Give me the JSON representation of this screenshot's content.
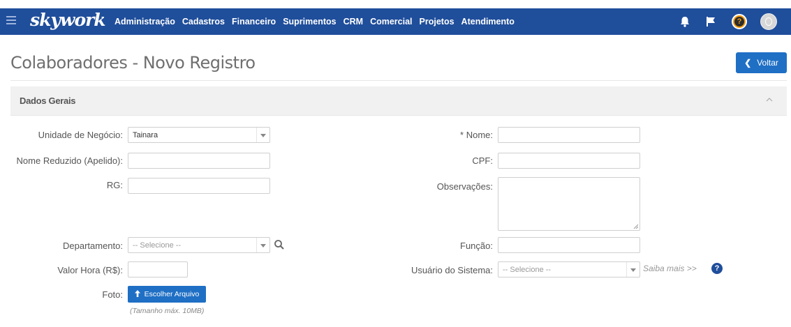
{
  "app": {
    "logo": "skywork",
    "menu": [
      "Administração",
      "Cadastros",
      "Financeiro",
      "Suprimentos",
      "CRM",
      "Comercial",
      "Projetos",
      "Atendimento"
    ],
    "icons": {
      "menu": "hamburger-icon",
      "bell": "bell-icon",
      "flag": "flag-icon",
      "help": "help-icon",
      "avatar": "avatar-icon"
    },
    "help_glyph": "?"
  },
  "page": {
    "title": "Colaboradores - Novo Registro",
    "back_button": "Voltar"
  },
  "section": {
    "title": "Dados Gerais",
    "collapse_glyph": "^"
  },
  "form": {
    "unidade_label": "Unidade de Negócio:",
    "unidade_value": "Tainara",
    "nome_reduzido_label": "Nome Reduzido (Apelido):",
    "nome_reduzido_value": "",
    "rg_label": "RG:",
    "rg_value": "",
    "departamento_label": "Departamento:",
    "departamento_value": "-- Selecione --",
    "valor_hora_label": "Valor Hora (R$):",
    "valor_hora_value": "",
    "foto_label": "Foto:",
    "foto_button": "Escolher Arquivo",
    "foto_hint": "(Tamanho máx. 10MB)",
    "nome_label": "* Nome:",
    "nome_value": "",
    "cpf_label": "CPF:",
    "cpf_value": "",
    "observacoes_label": "Observações:",
    "observacoes_value": "",
    "funcao_label": "Função:",
    "funcao_value": "",
    "usuario_label": "Usuário do Sistema:",
    "usuario_value": "-- Selecione --",
    "saiba_mais": "Saiba mais >>",
    "saiba_mais_glyph": "?"
  },
  "colors": {
    "navbar": "#1f4e9b",
    "primary_button": "#1f6fc5",
    "help_icon": "#f39c12",
    "section_header_bg": "#f1f1f1"
  }
}
